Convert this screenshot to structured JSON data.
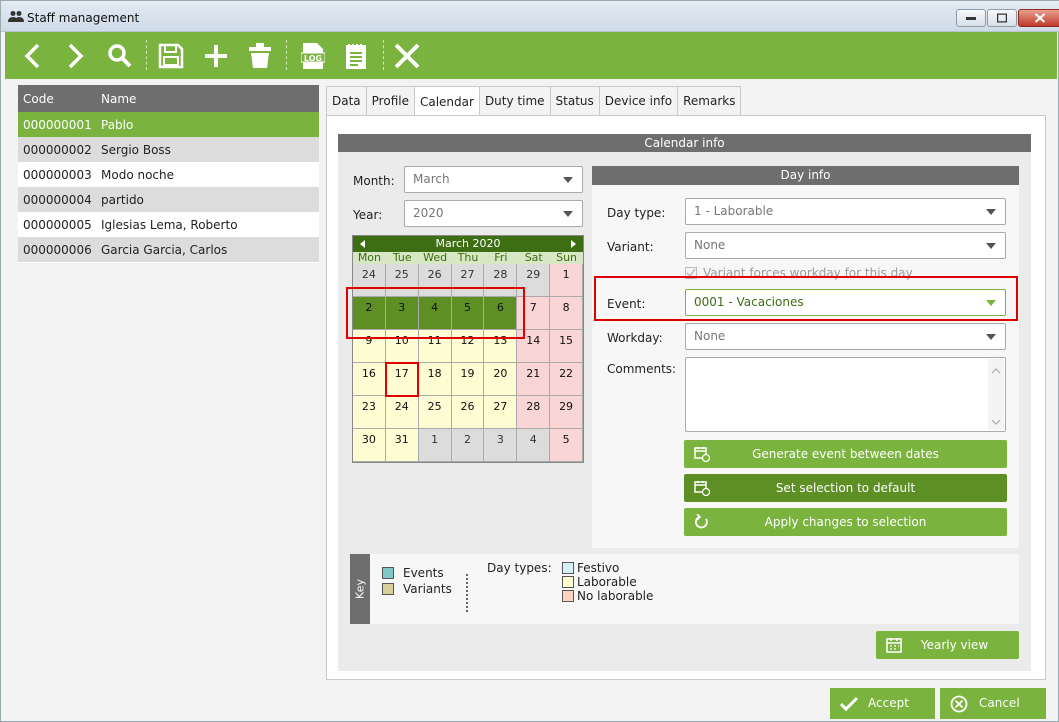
{
  "window": {
    "title": "Staff management"
  },
  "toolbar": {
    "icons": [
      "back-icon",
      "forward-icon",
      "search-icon",
      "save-icon",
      "add-icon",
      "delete-icon",
      "log-icon",
      "report-icon",
      "close-icon"
    ]
  },
  "staff_list": {
    "headers": {
      "code": "Code",
      "name": "Name"
    },
    "rows": [
      {
        "code": "000000001",
        "name": "Pablo"
      },
      {
        "code": "000000002",
        "name": "Sergio Boss"
      },
      {
        "code": "000000003",
        "name": "Modo noche"
      },
      {
        "code": "000000004",
        "name": "partido"
      },
      {
        "code": "000000005",
        "name": "Iglesias Lema, Roberto"
      },
      {
        "code": "000000006",
        "name": "Garcia Garcia, Carlos"
      }
    ]
  },
  "tabs": [
    "Data",
    "Profile",
    "Calendar",
    "Duty time",
    "Status",
    "Device info",
    "Remarks"
  ],
  "calendar_info": {
    "title": "Calendar info",
    "month_label": "Month:",
    "month_value": "March",
    "year_label": "Year:",
    "year_value": "2020",
    "calendar": {
      "header": "March 2020",
      "weekdays": [
        "Mon",
        "Tue",
        "Wed",
        "Thu",
        "Fri",
        "Sat",
        "Sun"
      ],
      "days": [
        "24",
        "25",
        "26",
        "27",
        "28",
        "29",
        "1",
        "2",
        "3",
        "4",
        "5",
        "6",
        "7",
        "8",
        "9",
        "10",
        "11",
        "12",
        "13",
        "14",
        "15",
        "16",
        "17",
        "18",
        "19",
        "20",
        "21",
        "22",
        "23",
        "24",
        "25",
        "26",
        "27",
        "28",
        "29",
        "30",
        "31",
        "1",
        "2",
        "3",
        "4",
        "5"
      ]
    }
  },
  "day_info": {
    "title": "Day info",
    "day_type_label": "Day type:",
    "day_type_value": "1 - Laborable",
    "variant_label": "Variant:",
    "variant_value": "None",
    "variant_forces_label": "Variant forces workday for this day",
    "event_label": "Event:",
    "event_value": "0001 - Vacaciones",
    "workday_label": "Workday:",
    "workday_value": "None",
    "comments_label": "Comments:",
    "comments_value": "",
    "buttons": {
      "generate": "Generate event between dates",
      "set_default": "Set selection to default",
      "apply": "Apply changes to selection"
    }
  },
  "key": {
    "title": "Key",
    "events": "Events",
    "variants": "Variants",
    "day_types_label": "Day types:",
    "festivo": "Festivo",
    "laborable": "Laborable",
    "no_laborable": "No laborable",
    "colors": {
      "events": "#7fc8c8",
      "variants": "#d8d09a",
      "festivo": "#d6f0f7",
      "laborable": "#fdfcd3",
      "no_laborable": "#fbd3c1"
    }
  },
  "yearly_view_label": "Yearly view",
  "footer": {
    "accept": "Accept",
    "cancel": "Cancel"
  }
}
